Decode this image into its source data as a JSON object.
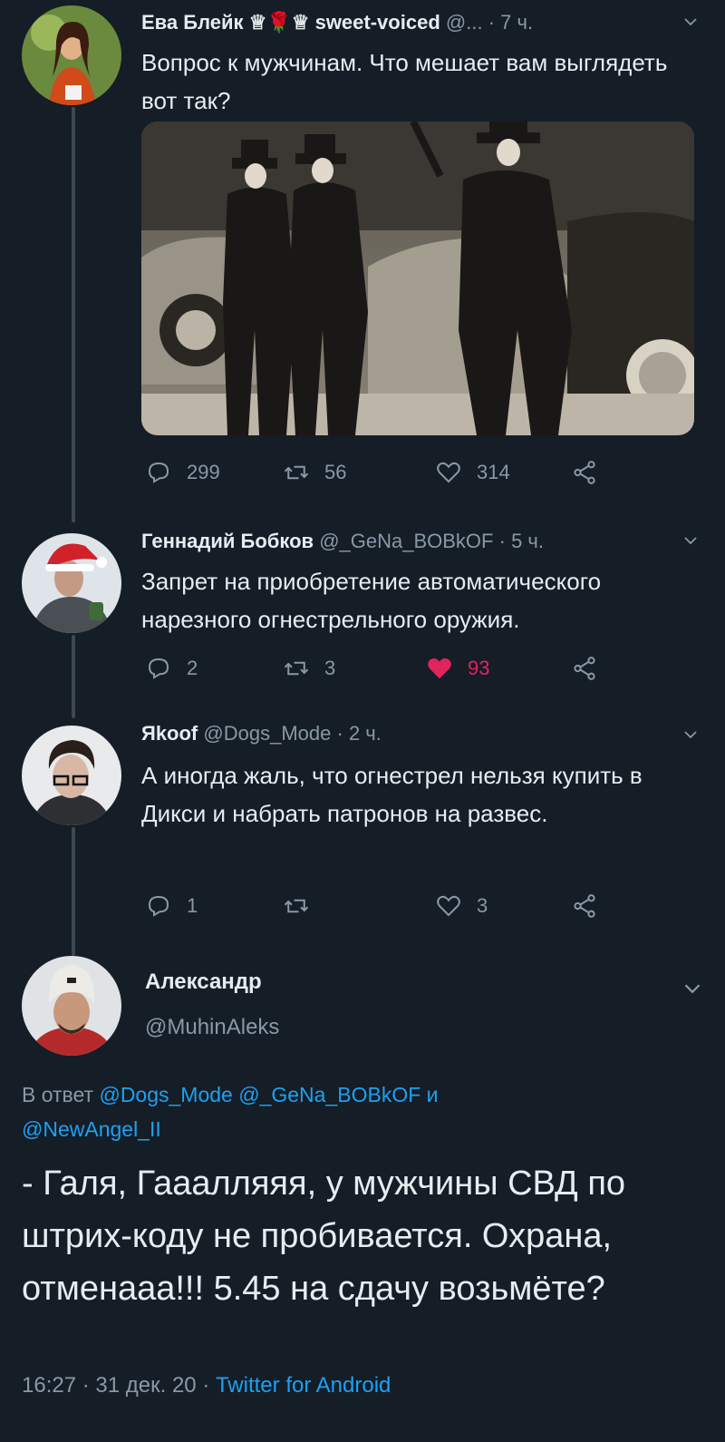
{
  "tweets": [
    {
      "name": "Ева Блейк ♕🌹♕ sweet-voiced",
      "handle": "@...",
      "time": "7 ч.",
      "text": "Вопрос к мужчинам. Что мешает вам выглядеть вот так?",
      "replies": "299",
      "retweets": "56",
      "likes": "314"
    },
    {
      "name": "Геннадий Бобков",
      "handle": "@_GeNa_BOBkOF",
      "time": "5 ч.",
      "text": "Запрет на приобретение автоматического нарезного огнестрельного оружия.",
      "replies": "2",
      "retweets": "3",
      "likes": "93"
    },
    {
      "name": "Яkoof",
      "handle": "@Dogs_Mode",
      "time": "2 ч.",
      "text": "А иногда жаль, что огнестрел нельзя купить в Дикси и набрать патронов на развес.",
      "replies": "1",
      "retweets": "",
      "likes": "3"
    }
  ],
  "main_tweet": {
    "name": "Александр",
    "handle": "@MuhinAleks",
    "reply_prefix": "В ответ",
    "reply_handle_1": "@Dogs_Mode",
    "reply_handle_2": "@_GeNa_BOBkOF",
    "reply_and": "и",
    "reply_handle_3": "@NewAngel_II",
    "text": "- Галя, Гааалляяя, у мужчины СВД по штрих-коду не пробивается. Охрана, отменааа!!! 5.45 на сдачу возьмёте?",
    "timestamp": "16:27 · 31 дек. 20 ·",
    "source": "Twitter for Android"
  },
  "colors": {
    "background": "#151d27",
    "link": "#1da1f2",
    "secondary_text": "#8899a6",
    "like_active": "#e0245e"
  },
  "icons": [
    "reply-icon",
    "retweet-icon",
    "like-icon",
    "share-icon",
    "chevron-down-icon"
  ]
}
